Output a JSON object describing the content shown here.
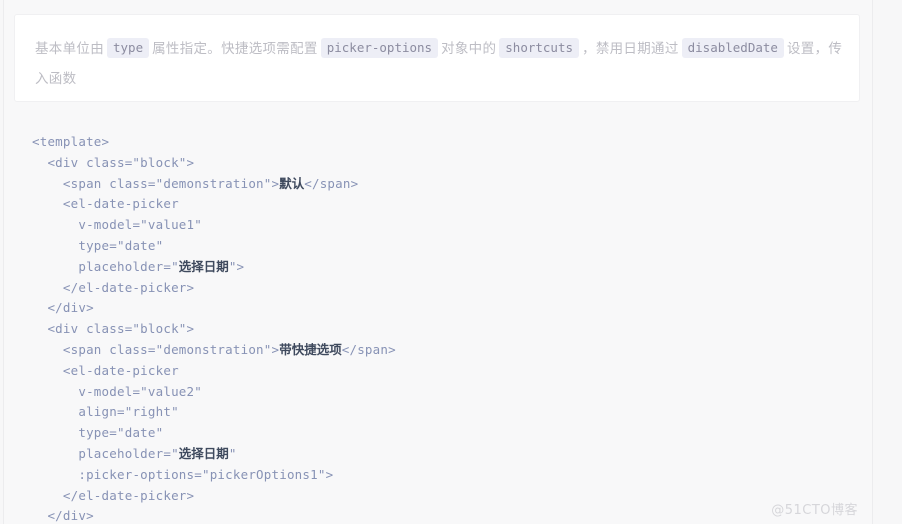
{
  "page": {
    "background_color": "#f7f7f8",
    "rule_color": "#ececee"
  },
  "description": {
    "card_background": "#ffffff",
    "text_color": "#b9b9c0",
    "chip_background": "#edeef6",
    "chip_text_color": "#8c8ca0",
    "segments": [
      {
        "type": "text",
        "value": "基本单位由"
      },
      {
        "type": "chip",
        "value": "type"
      },
      {
        "type": "text",
        "value": "属性指定。快捷选项需配置"
      },
      {
        "type": "chip",
        "value": "picker-options"
      },
      {
        "type": "text",
        "value": "对象中的"
      },
      {
        "type": "chip",
        "value": "shortcuts"
      },
      {
        "type": "text",
        "value": "，禁用日期通过"
      },
      {
        "type": "chip",
        "value": "disabledDate"
      },
      {
        "type": "text",
        "value": "设置，传入函数"
      }
    ]
  },
  "code": {
    "language": "html",
    "text_color": "#8792b5",
    "cjk_color": "#3f4a5e",
    "lines": [
      {
        "indent": 0,
        "parts": [
          {
            "t": "code",
            "v": "<template>"
          }
        ]
      },
      {
        "indent": 1,
        "parts": [
          {
            "t": "code",
            "v": "<div class=\"block\">"
          }
        ]
      },
      {
        "indent": 2,
        "parts": [
          {
            "t": "code",
            "v": "<span class=\"demonstration\">"
          },
          {
            "t": "cn",
            "v": "默认"
          },
          {
            "t": "code",
            "v": "</span>"
          }
        ]
      },
      {
        "indent": 2,
        "parts": [
          {
            "t": "code",
            "v": "<el-date-picker"
          }
        ]
      },
      {
        "indent": 3,
        "parts": [
          {
            "t": "code",
            "v": "v-model=\"value1\""
          }
        ]
      },
      {
        "indent": 3,
        "parts": [
          {
            "t": "code",
            "v": "type=\"date\""
          }
        ]
      },
      {
        "indent": 3,
        "parts": [
          {
            "t": "code",
            "v": "placeholder=\""
          },
          {
            "t": "cn",
            "v": "选择日期"
          },
          {
            "t": "code",
            "v": "\">"
          }
        ]
      },
      {
        "indent": 2,
        "parts": [
          {
            "t": "code",
            "v": "</el-date-picker>"
          }
        ]
      },
      {
        "indent": 1,
        "parts": [
          {
            "t": "code",
            "v": "</div>"
          }
        ]
      },
      {
        "indent": 1,
        "parts": [
          {
            "t": "code",
            "v": "<div class=\"block\">"
          }
        ]
      },
      {
        "indent": 2,
        "parts": [
          {
            "t": "code",
            "v": "<span class=\"demonstration\">"
          },
          {
            "t": "cn",
            "v": "带快捷选项"
          },
          {
            "t": "code",
            "v": "</span>"
          }
        ]
      },
      {
        "indent": 2,
        "parts": [
          {
            "t": "code",
            "v": "<el-date-picker"
          }
        ]
      },
      {
        "indent": 3,
        "parts": [
          {
            "t": "code",
            "v": "v-model=\"value2\""
          }
        ]
      },
      {
        "indent": 3,
        "parts": [
          {
            "t": "code",
            "v": "align=\"right\""
          }
        ]
      },
      {
        "indent": 3,
        "parts": [
          {
            "t": "code",
            "v": "type=\"date\""
          }
        ]
      },
      {
        "indent": 3,
        "parts": [
          {
            "t": "code",
            "v": "placeholder=\""
          },
          {
            "t": "cn",
            "v": "选择日期"
          },
          {
            "t": "code",
            "v": "\""
          }
        ]
      },
      {
        "indent": 3,
        "parts": [
          {
            "t": "code",
            "v": ":picker-options=\"pickerOptions1\">"
          }
        ]
      },
      {
        "indent": 2,
        "parts": [
          {
            "t": "code",
            "v": "</el-date-picker>"
          }
        ]
      },
      {
        "indent": 1,
        "parts": [
          {
            "t": "code",
            "v": "</div>"
          }
        ]
      }
    ]
  },
  "watermark": {
    "label": "@51CTO博客",
    "color": "#d6d6da"
  }
}
